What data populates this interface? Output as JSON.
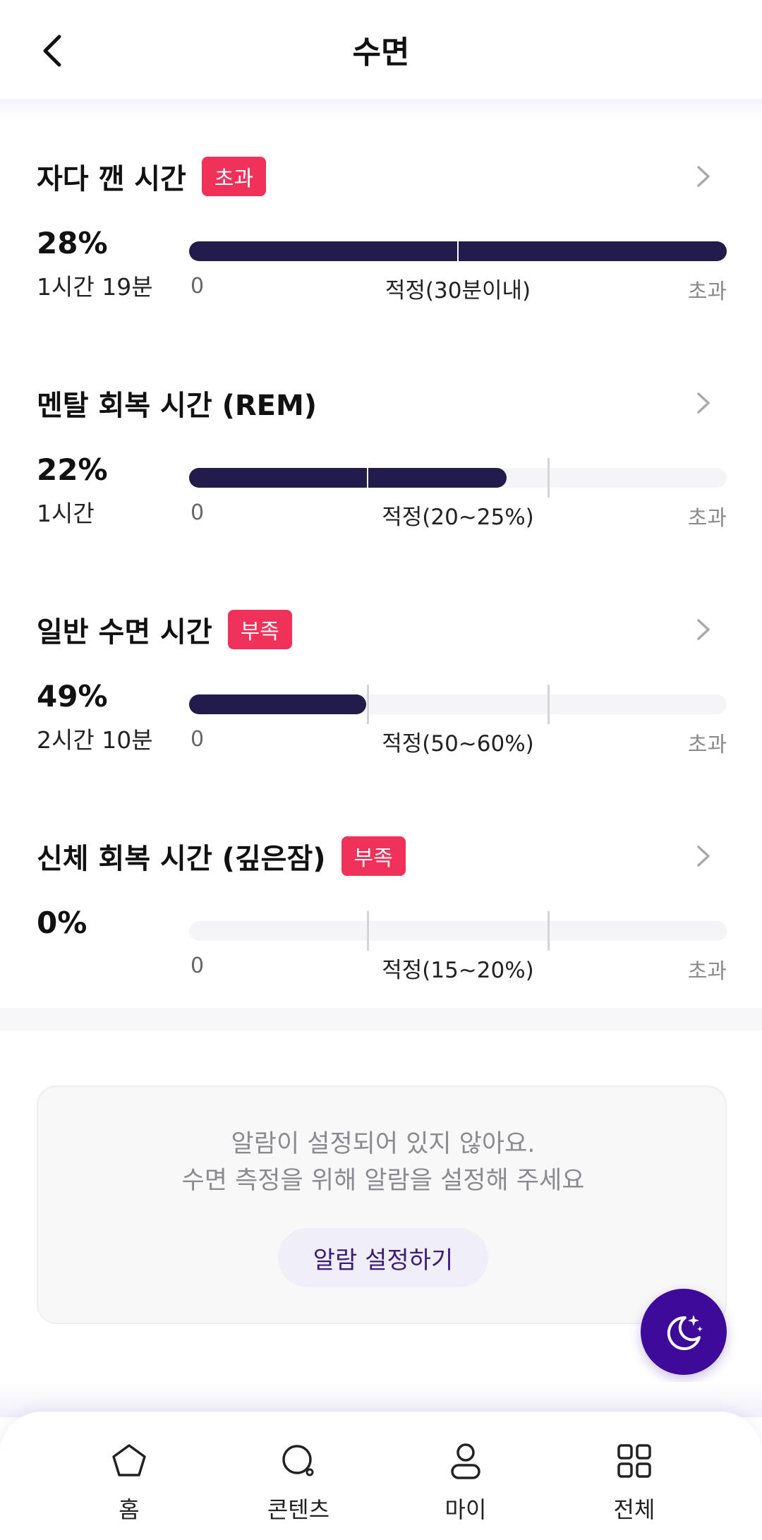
{
  "header": {
    "title": "수면",
    "back_icon": "chevron-left-icon"
  },
  "metrics": [
    {
      "title": "자다 깬 시간",
      "badge": "초과",
      "percent": "28%",
      "duration": "1시간 19분",
      "fill_fraction": 1.0,
      "range_label": "적정(30분이내)",
      "scale_start": "0",
      "scale_end": "초과"
    },
    {
      "title": "멘탈 회복 시간 (REM)",
      "badge": "",
      "percent": "22%",
      "duration": "1시간",
      "fill_fraction": 0.59,
      "range_label": "적정(20~25%)",
      "scale_start": "0",
      "scale_end": "초과"
    },
    {
      "title": "일반 수면 시간",
      "badge": "부족",
      "percent": "49%",
      "duration": "2시간 10분",
      "fill_fraction": 0.33,
      "range_label": "적정(50~60%)",
      "scale_start": "0",
      "scale_end": "초과"
    },
    {
      "title": "신체 회복 시간 (깊은잠)",
      "badge": "부족",
      "percent": "0%",
      "duration": "",
      "fill_fraction": 0.0,
      "range_label": "적정(15~20%)",
      "scale_start": "0",
      "scale_end": "초과"
    }
  ],
  "alarm": {
    "line1": "알람이 설정되어 있지 않아요.",
    "line2": "수면 측정을 위해 알람을 설정해 주세요",
    "button": "알람 설정하기"
  },
  "fab_icon": "moon-stars-icon",
  "bottom_nav": [
    {
      "label": "홈",
      "icon": "home-icon"
    },
    {
      "label": "콘텐츠",
      "icon": "search-icon"
    },
    {
      "label": "마이",
      "icon": "person-icon"
    },
    {
      "label": "전체",
      "icon": "grid-icon"
    }
  ],
  "colors": {
    "bar_fill": "#221c4b",
    "badge": "#f0325a",
    "fab": "#3d0a99",
    "alarm_button_text": "#3a1d7a"
  }
}
